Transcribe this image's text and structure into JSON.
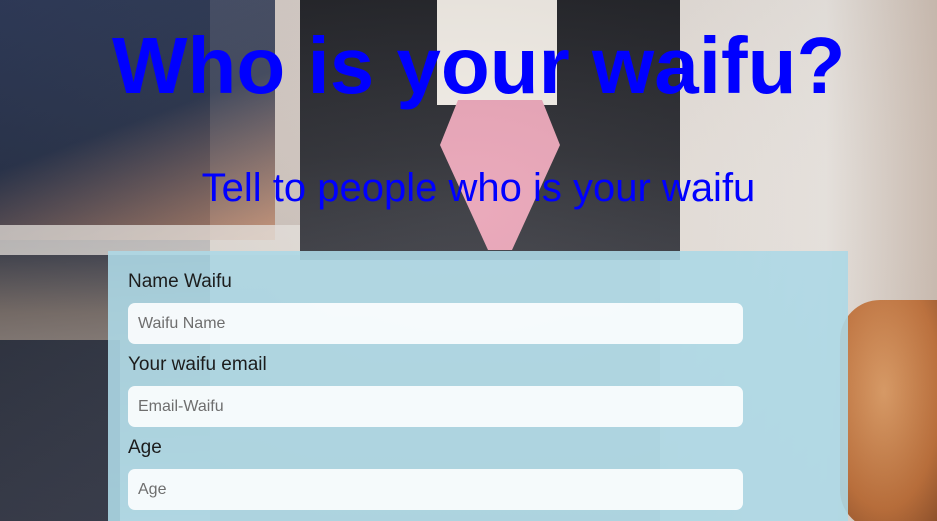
{
  "header": {
    "title": "Who is your waifu?",
    "subtitle": "Tell to people who is your waifu"
  },
  "form": {
    "fields": [
      {
        "label": "Name Waifu",
        "placeholder": "Waifu Name",
        "value": ""
      },
      {
        "label": "Your waifu email",
        "placeholder": "Email-Waifu",
        "value": ""
      },
      {
        "label": "Age",
        "placeholder": "Age",
        "value": ""
      }
    ]
  },
  "colors": {
    "heading": "#0000ff",
    "form_panel": "#add8e6",
    "label_text": "#1c1c1c"
  }
}
